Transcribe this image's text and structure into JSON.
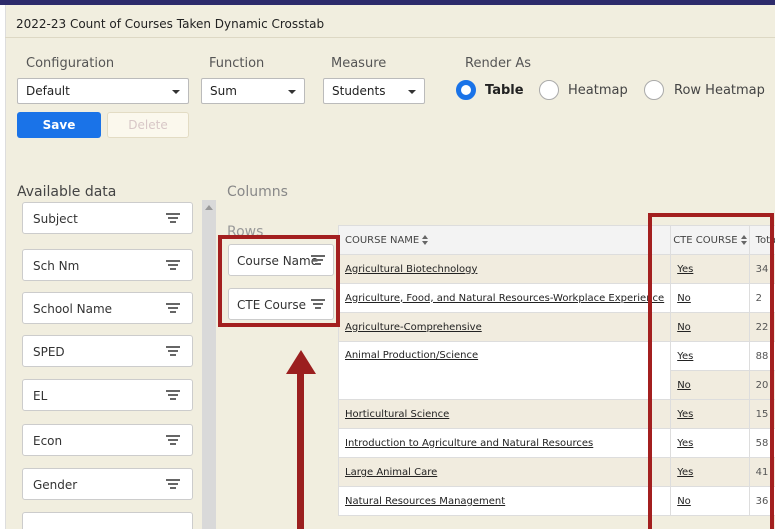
{
  "title": "2022-23 Count of Courses Taken Dynamic Crosstab",
  "controls": {
    "configuration_label": "Configuration",
    "configuration_value": "Default",
    "function_label": "Function",
    "function_value": "Sum",
    "measure_label": "Measure",
    "measure_value": "Students",
    "render_label": "Render As",
    "render_options": [
      "Table",
      "Heatmap",
      "Row Heatmap"
    ],
    "render_selected": "Table",
    "save_label": "Save",
    "delete_label": "Delete"
  },
  "available": {
    "label": "Available data",
    "items": [
      "Subject",
      "Sch Nm",
      "School Name",
      "SPED",
      "EL",
      "Econ",
      "Gender"
    ]
  },
  "columns_label": "Columns",
  "rows": {
    "label": "Rows",
    "items": [
      "Course Name",
      "CTE Course"
    ]
  },
  "table": {
    "headers": [
      "COURSE NAME",
      "CTE COURSE",
      "Totals"
    ],
    "rows": [
      {
        "course": "Agricultural Biotechnology",
        "cte": "Yes",
        "total": "34"
      },
      {
        "course": "Agriculture, Food, and Natural Resources-Workplace Experience",
        "cte": "No",
        "total": "2"
      },
      {
        "course": "Agriculture-Comprehensive",
        "cte": "No",
        "total": "22"
      },
      {
        "course": "Animal Production/Science",
        "cte": "Yes",
        "total": "88"
      },
      {
        "course": "",
        "cte": "No",
        "total": "20"
      },
      {
        "course": "Horticultural Science",
        "cte": "Yes",
        "total": "15"
      },
      {
        "course": "Introduction to Agriculture and Natural Resources",
        "cte": "Yes",
        "total": "58"
      },
      {
        "course": "Large Animal Care",
        "cte": "Yes",
        "total": "41"
      },
      {
        "course": "Natural Resources Management",
        "cte": "No",
        "total": "36"
      }
    ]
  },
  "colors": {
    "accent": "#1a73e8",
    "annotation": "#a31f1f",
    "panel": "#f1eedf"
  }
}
